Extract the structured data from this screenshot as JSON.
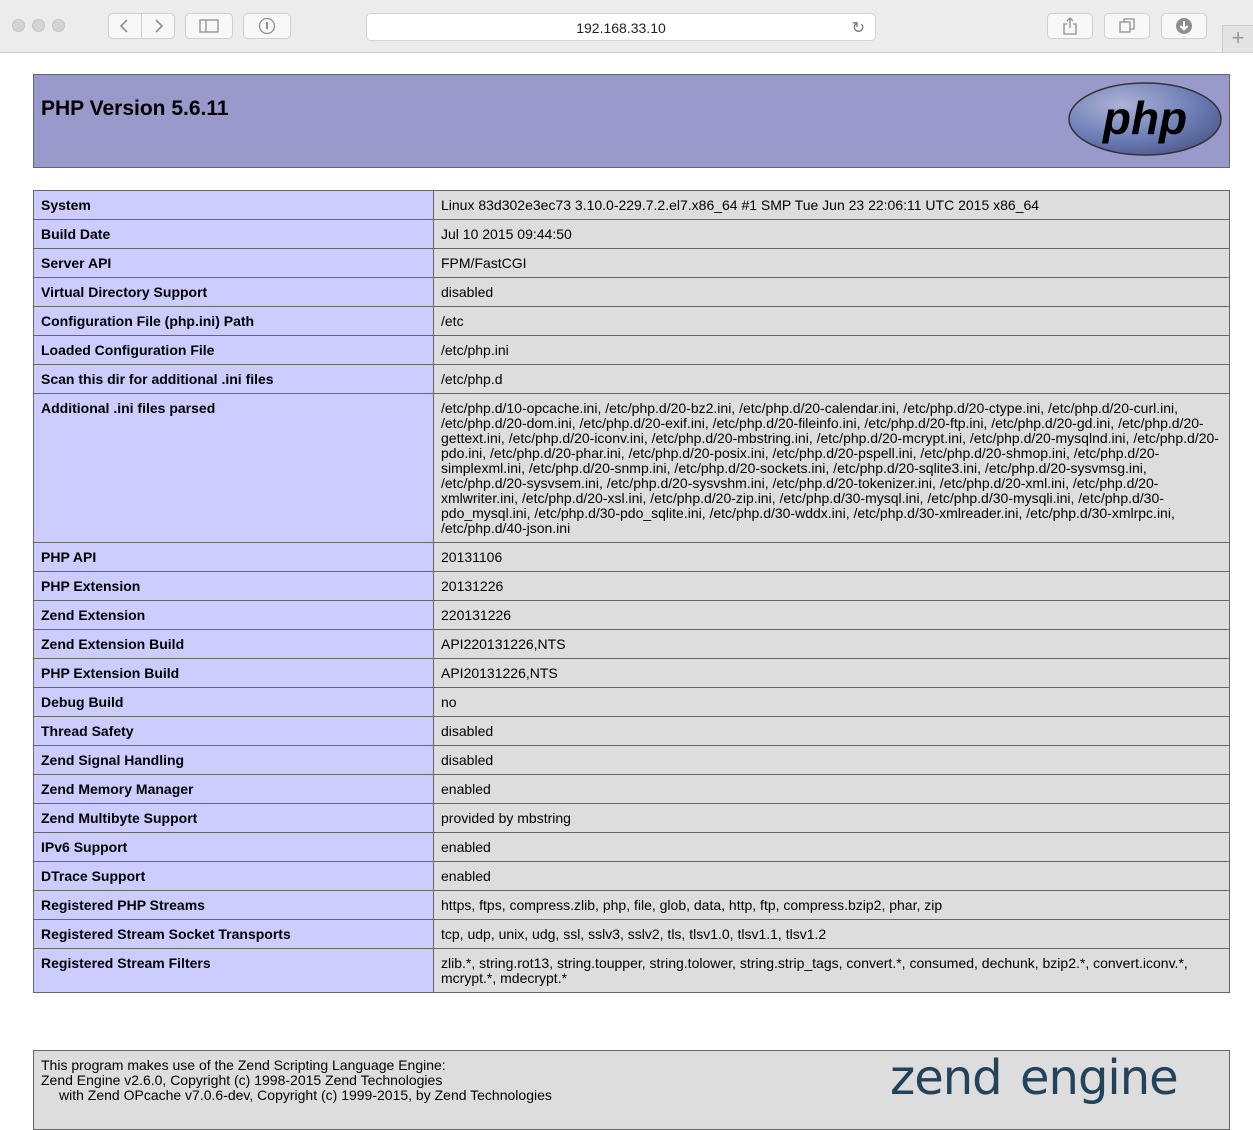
{
  "browser": {
    "url": "192.168.33.10",
    "reload_icon": "↻",
    "new_tab_label": "+"
  },
  "header": {
    "title": "PHP Version 5.6.11",
    "logo_text": "php"
  },
  "rows": [
    {
      "key": "System",
      "value": "Linux 83d302e3ec73 3.10.0-229.7.2.el7.x86_64 #1 SMP Tue Jun 23 22:06:11 UTC 2015 x86_64"
    },
    {
      "key": "Build Date",
      "value": "Jul 10 2015 09:44:50"
    },
    {
      "key": "Server API",
      "value": "FPM/FastCGI"
    },
    {
      "key": "Virtual Directory Support",
      "value": "disabled"
    },
    {
      "key": "Configuration File (php.ini) Path",
      "value": "/etc"
    },
    {
      "key": "Loaded Configuration File",
      "value": "/etc/php.ini"
    },
    {
      "key": "Scan this dir for additional .ini files",
      "value": "/etc/php.d"
    },
    {
      "key": "Additional .ini files parsed",
      "value": "/etc/php.d/10-opcache.ini, /etc/php.d/20-bz2.ini, /etc/php.d/20-calendar.ini, /etc/php.d/20-ctype.ini, /etc/php.d/20-curl.ini, /etc/php.d/20-dom.ini, /etc/php.d/20-exif.ini, /etc/php.d/20-fileinfo.ini, /etc/php.d/20-ftp.ini, /etc/php.d/20-gd.ini, /etc/php.d/20-gettext.ini, /etc/php.d/20-iconv.ini, /etc/php.d/20-mbstring.ini, /etc/php.d/20-mcrypt.ini, /etc/php.d/20-mysqlnd.ini, /etc/php.d/20-pdo.ini, /etc/php.d/20-phar.ini, /etc/php.d/20-posix.ini, /etc/php.d/20-pspell.ini, /etc/php.d/20-shmop.ini, /etc/php.d/20-simplexml.ini, /etc/php.d/20-snmp.ini, /etc/php.d/20-sockets.ini, /etc/php.d/20-sqlite3.ini, /etc/php.d/20-sysvmsg.ini, /etc/php.d/20-sysvsem.ini, /etc/php.d/20-sysvshm.ini, /etc/php.d/20-tokenizer.ini, /etc/php.d/20-xml.ini, /etc/php.d/20-xmlwriter.ini, /etc/php.d/20-xsl.ini, /etc/php.d/20-zip.ini, /etc/php.d/30-mysql.ini, /etc/php.d/30-mysqli.ini, /etc/php.d/30-pdo_mysql.ini, /etc/php.d/30-pdo_sqlite.ini, /etc/php.d/30-wddx.ini, /etc/php.d/30-xmlreader.ini, /etc/php.d/30-xmlrpc.ini, /etc/php.d/40-json.ini"
    },
    {
      "key": "PHP API",
      "value": "20131106"
    },
    {
      "key": "PHP Extension",
      "value": "20131226"
    },
    {
      "key": "Zend Extension",
      "value": "220131226"
    },
    {
      "key": "Zend Extension Build",
      "value": "API220131226,NTS"
    },
    {
      "key": "PHP Extension Build",
      "value": "API20131226,NTS"
    },
    {
      "key": "Debug Build",
      "value": "no"
    },
    {
      "key": "Thread Safety",
      "value": "disabled"
    },
    {
      "key": "Zend Signal Handling",
      "value": "disabled"
    },
    {
      "key": "Zend Memory Manager",
      "value": "enabled"
    },
    {
      "key": "Zend Multibyte Support",
      "value": "provided by mbstring"
    },
    {
      "key": "IPv6 Support",
      "value": "enabled"
    },
    {
      "key": "DTrace Support",
      "value": "enabled"
    },
    {
      "key": "Registered PHP Streams",
      "value": "https, ftps, compress.zlib, php, file, glob, data, http, ftp, compress.bzip2, phar, zip"
    },
    {
      "key": "Registered Stream Socket Transports",
      "value": "tcp, udp, unix, udg, ssl, sslv3, sslv2, tls, tlsv1.0, tlsv1.1, tlsv1.2"
    },
    {
      "key": "Registered Stream Filters",
      "value": "zlib.*, string.rot13, string.toupper, string.tolower, string.strip_tags, convert.*, consumed, dechunk, bzip2.*, convert.iconv.*, mcrypt.*, mdecrypt.*"
    }
  ],
  "footer": {
    "line1": "This program makes use of the Zend Scripting Language Engine:",
    "line2": "Zend Engine v2.6.0, Copyright (c) 1998-2015 Zend Technologies",
    "line3": "with Zend OPcache v7.0.6-dev, Copyright (c) 1999-2015, by Zend Technologies",
    "logo_text_left": "zend",
    "logo_text_right": "engine"
  },
  "colors": {
    "header_bg": "#9999cc",
    "key_bg": "#ccccff",
    "value_bg": "#dddddd",
    "border": "#666666"
  }
}
